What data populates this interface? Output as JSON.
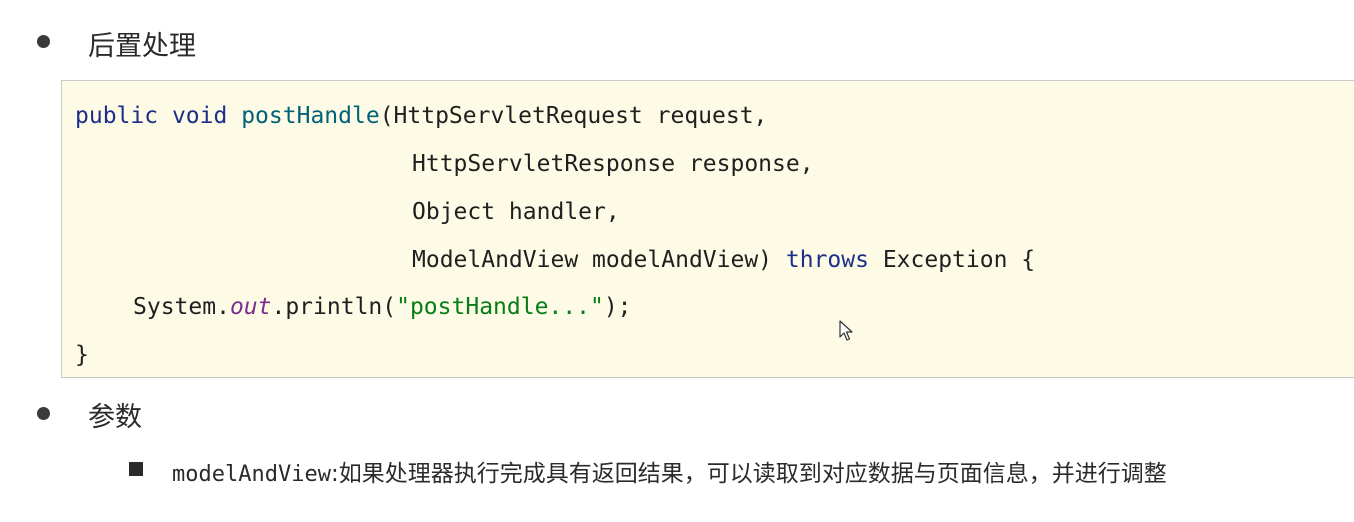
{
  "section1": {
    "heading": "后置处理"
  },
  "code": {
    "line1_kw1": "public",
    "line1_kw2": "void",
    "line1_fn": "postHandle",
    "line1_rest": "(HttpServletRequest request,",
    "line2": "HttpServletResponse response,",
    "line3": "Object handler,",
    "line4_a": "ModelAndView modelAndView) ",
    "line4_kw": "throws",
    "line4_b": " Exception {",
    "line5_a": "System.",
    "line5_it": "out",
    "line5_b": ".println(",
    "line5_str": "\"postHandle...\"",
    "line5_c": ");",
    "line6": "}"
  },
  "section2": {
    "heading": "参数",
    "param_name": "modelAndView",
    "param_desc": ":如果处理器执行完成具有返回结果，可以读取到对应数据与页面信息，并进行调整"
  },
  "icons": {
    "bullet": "bullet-dot-icon",
    "square_bullet": "square-bullet-icon",
    "cursor": "mouse-pointer-icon"
  }
}
